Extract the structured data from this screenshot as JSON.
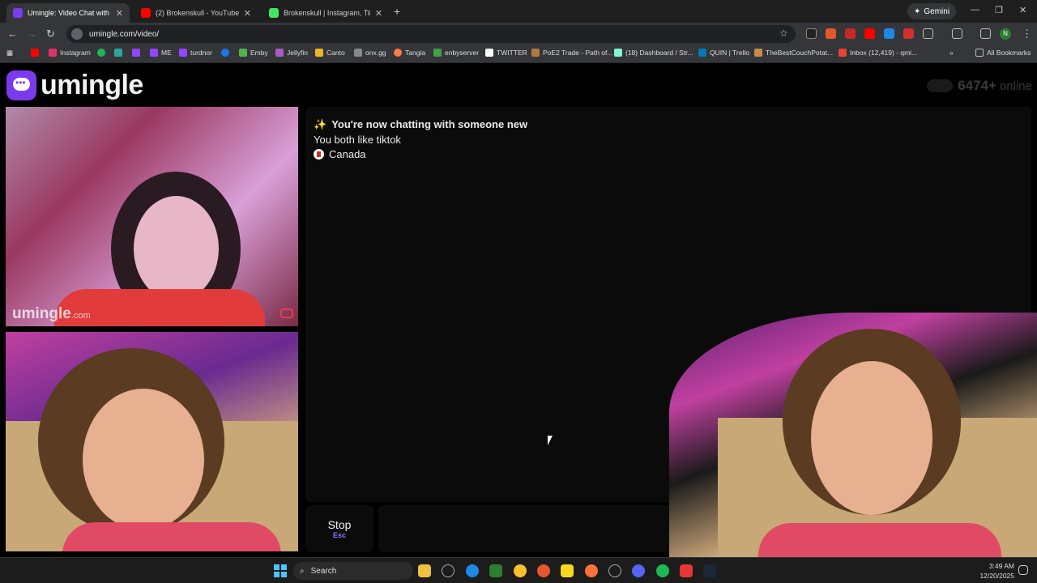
{
  "browser": {
    "tabs": [
      {
        "title": "Umingle: Video Chat with S",
        "icon": "umingle-icon",
        "color": "#7c3aed",
        "active": true
      },
      {
        "title": "(2) Brokenskull - YouTube",
        "icon": "youtube-icon",
        "color": "#ff0000",
        "active": false
      },
      {
        "title": "Brokenskull | Instagram, TikTok",
        "icon": "linktree-icon",
        "color": "#43e660",
        "active": false
      }
    ],
    "gemini_label": "Gemini",
    "url": "umingle.com/video/",
    "profile_initial": "N",
    "bookmarks": [
      {
        "label": "",
        "icon": "youtube-icon",
        "color": "#ff0000"
      },
      {
        "label": "Instagram",
        "icon": "instagram-icon",
        "color": "#e1306c"
      },
      {
        "label": "",
        "icon": "spotify-icon",
        "color": "#1db954"
      },
      {
        "label": "",
        "icon": "app-icon",
        "color": "#2ea6a0"
      },
      {
        "label": "",
        "icon": "twitch-icon",
        "color": "#9146ff"
      },
      {
        "label": "ME",
        "icon": "twitch-icon",
        "color": "#9146ff"
      },
      {
        "label": "turdnor",
        "icon": "twitch-icon",
        "color": "#9146ff"
      },
      {
        "label": "",
        "icon": "facebook-icon",
        "color": "#1877f2"
      },
      {
        "label": "Emby",
        "icon": "emby-icon",
        "color": "#52b54b"
      },
      {
        "label": "Jellyfin",
        "icon": "jellyfin-icon",
        "color": "#aa5cc3"
      },
      {
        "label": "Canto",
        "icon": "folder-icon",
        "color": "#f0b429"
      },
      {
        "label": "onx.gg",
        "icon": "onx-icon",
        "color": "#888888"
      },
      {
        "label": "Tangia",
        "icon": "tangia-icon",
        "color": "#ff7a45"
      },
      {
        "label": "enbyserver",
        "icon": "server-icon",
        "color": "#43a047"
      },
      {
        "label": "TWITTER",
        "icon": "x-icon",
        "color": "#ffffff"
      },
      {
        "label": "PoE2 Trade - Path of...",
        "icon": "poe-icon",
        "color": "#b07a3a"
      },
      {
        "label": "(18) Dashboard / Str...",
        "icon": "streamlabs-icon",
        "color": "#80f5d2"
      },
      {
        "label": "QUIN | Trello",
        "icon": "trello-icon",
        "color": "#0079bf"
      },
      {
        "label": "TheBestCouchPotat...",
        "icon": "potato-icon",
        "color": "#c98a4b"
      },
      {
        "label": "Inbox (12,419) - qmi...",
        "icon": "gmail-icon",
        "color": "#ea4335"
      }
    ],
    "all_bookmarks": "All Bookmarks"
  },
  "site": {
    "logo_text": "umingle",
    "online_count": "6474+",
    "online_label": "online",
    "watermark_main": "umingle",
    "watermark_suffix": ".com"
  },
  "chat": {
    "headline": "You're now chatting with someone new",
    "interest": "You both like tiktok",
    "country": "Canada",
    "stop_label": "Stop",
    "stop_hint": "Esc"
  },
  "taskbar": {
    "search_placeholder": "Search",
    "time": "3:49 AM",
    "date": "12/20/2025"
  }
}
